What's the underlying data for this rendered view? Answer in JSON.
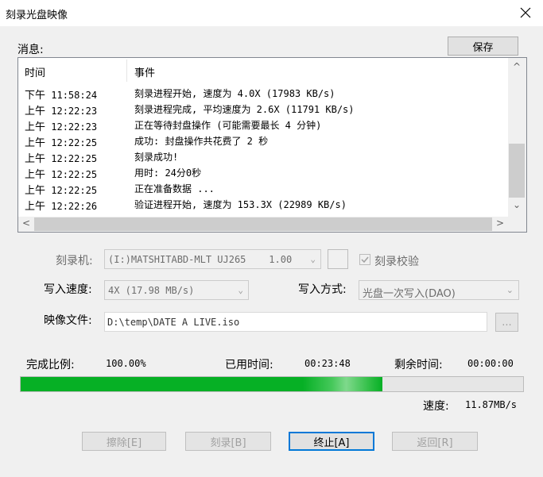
{
  "window": {
    "title": "刻录光盘映像"
  },
  "messages": {
    "label": "消息:",
    "save_label": "保存",
    "columns": [
      "时间",
      "事件"
    ],
    "rows": [
      {
        "period": "下午",
        "time": "11:58:24",
        "event": "刻录进程开始, 速度为 4.0X (17983 KB/s)"
      },
      {
        "period": "上午",
        "time": "12:22:23",
        "event": "刻录进程完成, 平均速度为 2.6X (11791 KB/s)"
      },
      {
        "period": "上午",
        "time": "12:22:23",
        "event": "正在等待封盘操作 (可能需要最长 4 分钟)"
      },
      {
        "period": "上午",
        "time": "12:22:25",
        "event": "成功: 封盘操作共花费了 2 秒"
      },
      {
        "period": "上午",
        "time": "12:22:25",
        "event": "刻录成功!"
      },
      {
        "period": "上午",
        "time": "12:22:25",
        "event": "用时: 24分0秒"
      },
      {
        "period": "上午",
        "time": "12:22:25",
        "event": "正在准备数据 ..."
      },
      {
        "period": "上午",
        "time": "12:22:26",
        "event": "验证进程开始, 速度为 153.3X (22989 KB/s)"
      }
    ]
  },
  "burner": {
    "label": "刻录机:",
    "value": "(I:)MATSHITABD-MLT UJ265    1.00",
    "verify_label": "刻录校验",
    "verify_checked": true
  },
  "write_speed": {
    "label": "写入速度:",
    "value": "4X (17.98 MB/s)"
  },
  "write_mode": {
    "label": "写入方式:",
    "value": "光盘一次写入(DAO)"
  },
  "image_file": {
    "label": "映像文件:",
    "value": "D:\\temp\\DATE A LIVE.iso",
    "browse_label": "..."
  },
  "status": {
    "complete_label": "完成比例:",
    "complete_value": "100.00%",
    "elapsed_label": "已用时间:",
    "elapsed_value": "00:23:48",
    "remaining_label": "剩余时间:",
    "remaining_value": "00:00:00",
    "progress_fraction": 0.72,
    "speed_label": "速度:",
    "speed_value": "11.87MB/s"
  },
  "buttons": {
    "erase": "擦除[E]",
    "burn": "刻录[B]",
    "stop": "终止[A]",
    "back": "返回[R]"
  },
  "colors": {
    "progress": "#06b025",
    "focus": "#0078d7"
  }
}
